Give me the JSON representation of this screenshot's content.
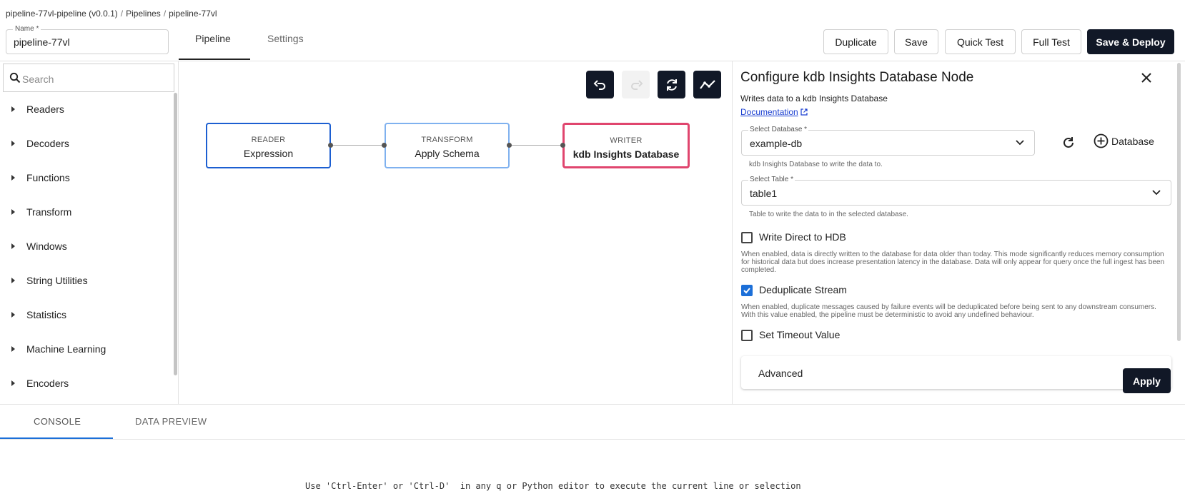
{
  "breadcrumb": {
    "items": [
      "pipeline-77vl-pipeline (v0.0.1)",
      "Pipelines",
      "pipeline-77vl"
    ],
    "separator": "/"
  },
  "name_field": {
    "label": "Name *",
    "value": "pipeline-77vl"
  },
  "tabs": [
    {
      "label": "Pipeline",
      "active": true
    },
    {
      "label": "Settings",
      "active": false
    }
  ],
  "toolbar": {
    "duplicate": "Duplicate",
    "save": "Save",
    "quick_test": "Quick Test",
    "full_test": "Full Test",
    "save_deploy": "Save & Deploy"
  },
  "sidebar": {
    "search_placeholder": "Search",
    "items": [
      "Readers",
      "Decoders",
      "Functions",
      "Transform",
      "Windows",
      "String Utilities",
      "Statistics",
      "Machine Learning",
      "Encoders"
    ]
  },
  "canvas": {
    "tools": [
      "undo-icon",
      "redo-icon",
      "refresh-icon",
      "layout-icon"
    ],
    "nodes": [
      {
        "type": "READER",
        "title": "Expression"
      },
      {
        "type": "TRANSFORM",
        "title": "Apply Schema"
      },
      {
        "type": "WRITER",
        "title": "kdb Insights Database"
      }
    ]
  },
  "panel": {
    "title": "Configure kdb Insights Database Node",
    "description": "Writes data to a kdb Insights Database",
    "doc_link": "Documentation",
    "database": {
      "label": "Select Database *",
      "value": "example-db",
      "hint": "kdb Insights Database to write the data to."
    },
    "add_database": "Database",
    "table": {
      "label": "Select Table *",
      "value": "table1",
      "hint": "Table to write the data to in the selected database."
    },
    "write_direct": {
      "label": "Write Direct to HDB",
      "checked": false,
      "desc": "When enabled, data is directly written to the database for data older than today. This mode significantly reduces memory consumption for historical data but does increase presentation latency in the database. Data will only appear for query once the full ingest has been completed."
    },
    "dedup": {
      "label": "Deduplicate Stream",
      "checked": true,
      "desc": "When enabled, duplicate messages caused by failure events will be deduplicated before being sent to any downstream consumers. With this value enabled, the pipeline must be deterministic to avoid any undefined behaviour."
    },
    "timeout": {
      "label": "Set Timeout Value",
      "checked": false
    },
    "advanced": "Advanced",
    "apply": "Apply"
  },
  "bottom": {
    "tabs": [
      "CONSOLE",
      "DATA PREVIEW"
    ],
    "console_message": "Use 'Ctrl-Enter' or 'Ctrl-D'  in any q or Python editor to execute the current line or selection"
  },
  "colors": {
    "primary_button": "#111827",
    "reader_border": "#1c5fd1",
    "transform_border": "#7fb1ef",
    "writer_border": "#e0456e",
    "accent": "#1c6fd8"
  }
}
